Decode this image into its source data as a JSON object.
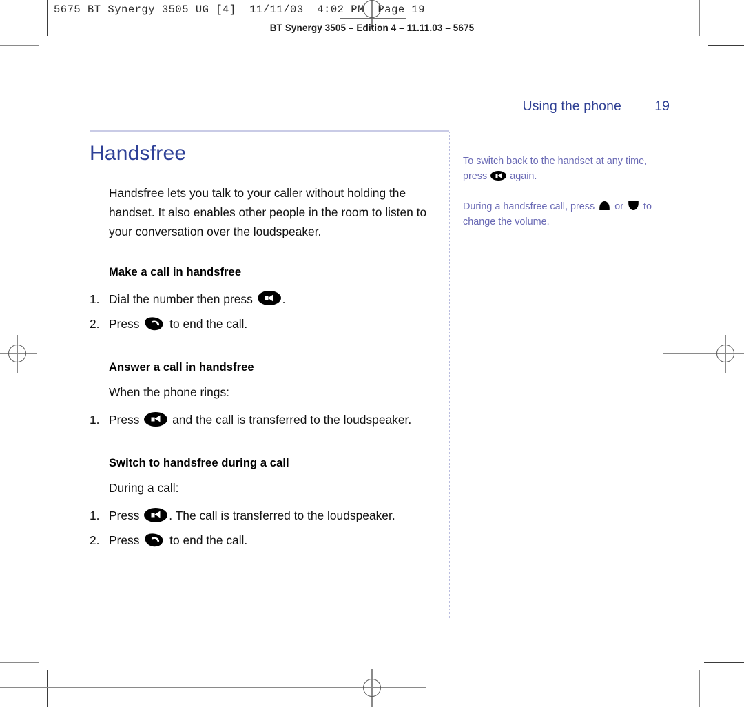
{
  "printer_marks": {
    "slug_mono": "5675 BT Synergy 3505 UG [4]  11/11/03  4:02 PM  Page 19",
    "slug_caption": "BT Synergy 3505 – Edition 4 – 11.11.03 – 5675"
  },
  "page_header": {
    "section_name": "Using the phone",
    "page_number": "19"
  },
  "main": {
    "title": "Handsfree",
    "intro": "Handsfree lets you talk to your caller without holding the handset. It also enables other people in the room to listen to your conversation over the loudspeaker.",
    "sections": [
      {
        "heading": "Make a call in handsfree",
        "lead": "",
        "steps": [
          {
            "num": "1.",
            "before": "Dial the number then press",
            "icon": "speaker-icon",
            "after": "."
          },
          {
            "num": "2.",
            "before": "Press",
            "icon": "end-call-icon",
            "after": "to end the call."
          }
        ]
      },
      {
        "heading": "Answer a call in handsfree",
        "lead": "When the phone rings:",
        "steps": [
          {
            "num": "1.",
            "before": "Press",
            "icon": "speaker-icon",
            "after": "and the call is transferred to the loudspeaker."
          }
        ]
      },
      {
        "heading": "Switch to handsfree during a call",
        "lead": "During a call:",
        "steps": [
          {
            "num": "1.",
            "before": "Press",
            "icon": "speaker-icon",
            "after": ". The call is transferred to the loudspeaker."
          },
          {
            "num": "2.",
            "before": "Press",
            "icon": "end-call-icon",
            "after": "to end the call."
          }
        ]
      }
    ]
  },
  "sidebar": {
    "notes": [
      {
        "part1": "To switch back to the handset at any time, press",
        "icon1": "speaker-icon",
        "part2": "again.",
        "icon2": "",
        "part3": ""
      },
      {
        "part1": "During a handsfree call, press",
        "icon1": "volume-up-icon",
        "part2": "or",
        "icon2": "volume-down-icon",
        "part3": "to change the volume."
      }
    ]
  },
  "colors": {
    "heading_blue": "#2e4097",
    "sidebar_purple": "#6a6ab5",
    "rule_lavender": "#c9cbe6",
    "body_black": "#111111"
  }
}
